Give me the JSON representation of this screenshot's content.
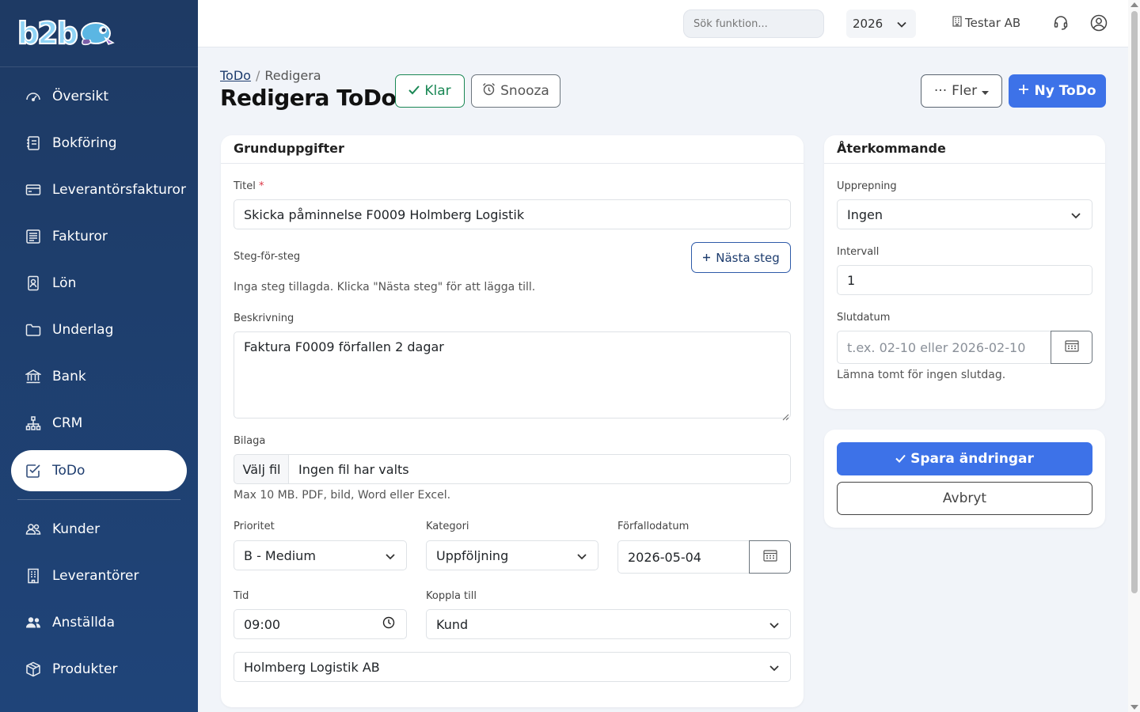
{
  "app": {
    "logo_text": "b2b"
  },
  "sidebar": {
    "items": [
      {
        "label": "Översikt",
        "icon": "speedometer-icon"
      },
      {
        "label": "Bokföring",
        "icon": "journal-icon"
      },
      {
        "label": "Leverantörsfakturor",
        "icon": "credit-card-icon"
      },
      {
        "label": "Fakturor",
        "icon": "receipt-icon"
      },
      {
        "label": "Lön",
        "icon": "badge-icon"
      },
      {
        "label": "Underlag",
        "icon": "folder-icon"
      },
      {
        "label": "Bank",
        "icon": "bank-icon"
      },
      {
        "label": "CRM",
        "icon": "diagram-icon"
      },
      {
        "label": "ToDo",
        "icon": "check-square-icon",
        "active": true
      },
      {
        "label": "Kunder",
        "icon": "people-icon"
      },
      {
        "label": "Leverantörer",
        "icon": "building-icon"
      },
      {
        "label": "Anställda",
        "icon": "people-fill-icon"
      },
      {
        "label": "Produkter",
        "icon": "box-icon"
      }
    ]
  },
  "topbar": {
    "search_placeholder": "Sök funktion...",
    "year": "2026",
    "company": "Testar AB"
  },
  "page": {
    "breadcrumb_link": "ToDo",
    "breadcrumb_current": "Redigera",
    "title": "Redigera ToDo",
    "klar_label": "Klar",
    "snooza_label": "Snooza",
    "fler_label": "Fler",
    "ny_label": "Ny ToDo"
  },
  "main": {
    "heading": "Grunduppgifter",
    "titel_label": "Titel",
    "titel_value": "Skicka påminnelse F0009 Holmberg Logistik",
    "steg_label": "Steg-för-steg",
    "nasta_steg_label": "Nästa steg",
    "steg_empty": "Inga steg tillagda. Klicka \"Nästa steg\" för att lägga till.",
    "beskrivning_label": "Beskrivning",
    "beskrivning_value": "Faktura F0009 förfallen 2 dagar",
    "bilaga_label": "Bilaga",
    "file_button": "Välj fil",
    "file_status": "Ingen fil har valts",
    "file_help": "Max 10 MB. PDF, bild, Word eller Excel.",
    "prioritet_label": "Prioritet",
    "prioritet_value": "B - Medium",
    "kategori_label": "Kategori",
    "kategori_value": "Uppföljning",
    "forfallo_label": "Förfallodatum",
    "forfallo_value": "2026-05-04",
    "tid_label": "Tid",
    "tid_value": "09:00",
    "koppla_label": "Koppla till",
    "koppla_value": "Kund",
    "kund_value": "Holmberg Logistik AB"
  },
  "side": {
    "heading": "Återkommande",
    "upprepning_label": "Upprepning",
    "upprepning_value": "Ingen",
    "intervall_label": "Intervall",
    "intervall_value": "1",
    "slutdatum_label": "Slutdatum",
    "slutdatum_placeholder": "t.ex. 02-10 eller 2026-02-10",
    "slutdatum_help": "Lämna tomt för ingen slutdag."
  },
  "actions": {
    "save_label": "Spara ändringar",
    "cancel_label": "Avbryt"
  },
  "colors": {
    "sidebar": "#1e3a64",
    "primary": "#3d72e8",
    "success": "#198754"
  }
}
